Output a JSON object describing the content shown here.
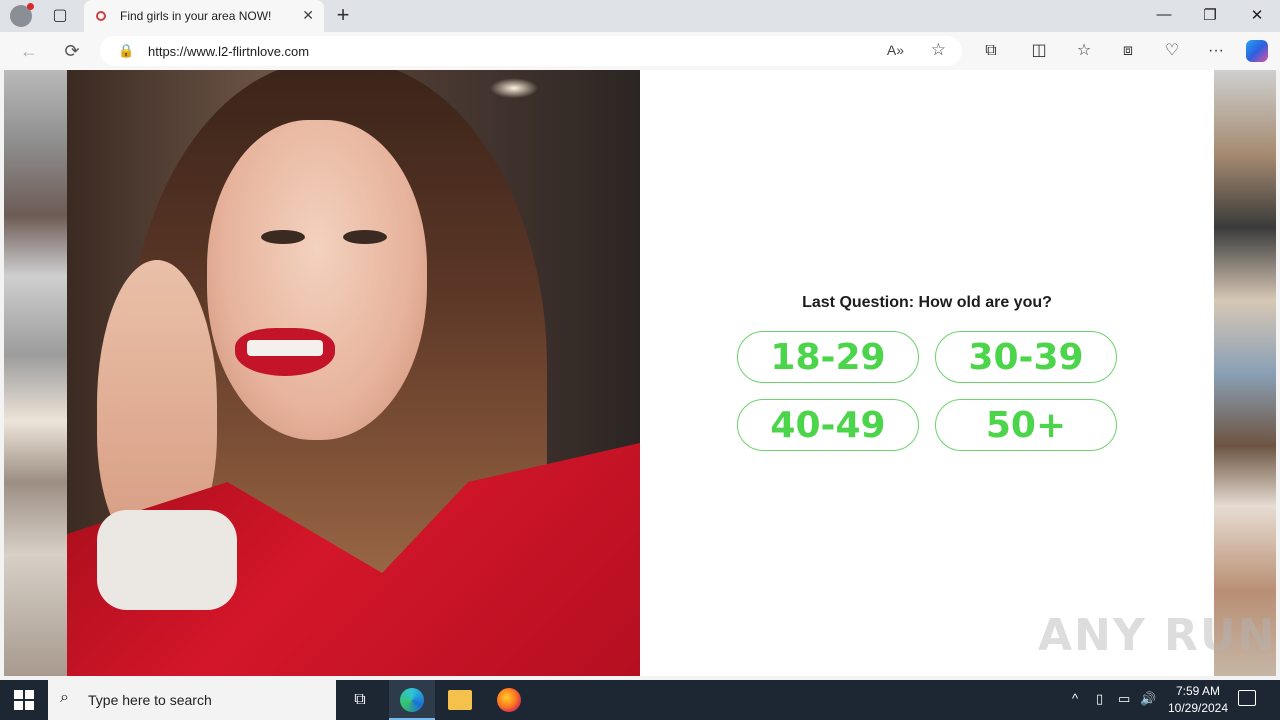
{
  "browser": {
    "tab_title": "Find girls in your area NOW!",
    "tab_close": "✕",
    "new_tab": "+",
    "url": "https://www.l2-flirtnlove.com",
    "window_controls": {
      "minimize": "—",
      "restore": "❐",
      "close": "✕"
    },
    "nav": {
      "back": "←",
      "reload": "⟳"
    },
    "read_aloud": "A»",
    "favorite": "☆",
    "toolbar": {
      "extensions": "⧉",
      "split": "◫",
      "favorites": "☆",
      "collections": "⧈",
      "performance": "♡",
      "more": "···"
    }
  },
  "quiz": {
    "question": "Last Question: How old are you?",
    "answers": [
      "18-29",
      "30-39",
      "40-49",
      "50+"
    ],
    "accent_color": "#4cd44a"
  },
  "watermark": "ANY RUN",
  "taskbar": {
    "search_placeholder": "Type here to search",
    "task_view": "⧉",
    "tray": {
      "chevron": "^",
      "network": "▭",
      "volume": "🔊"
    },
    "time": "7:59 AM",
    "date": "10/29/2024"
  }
}
